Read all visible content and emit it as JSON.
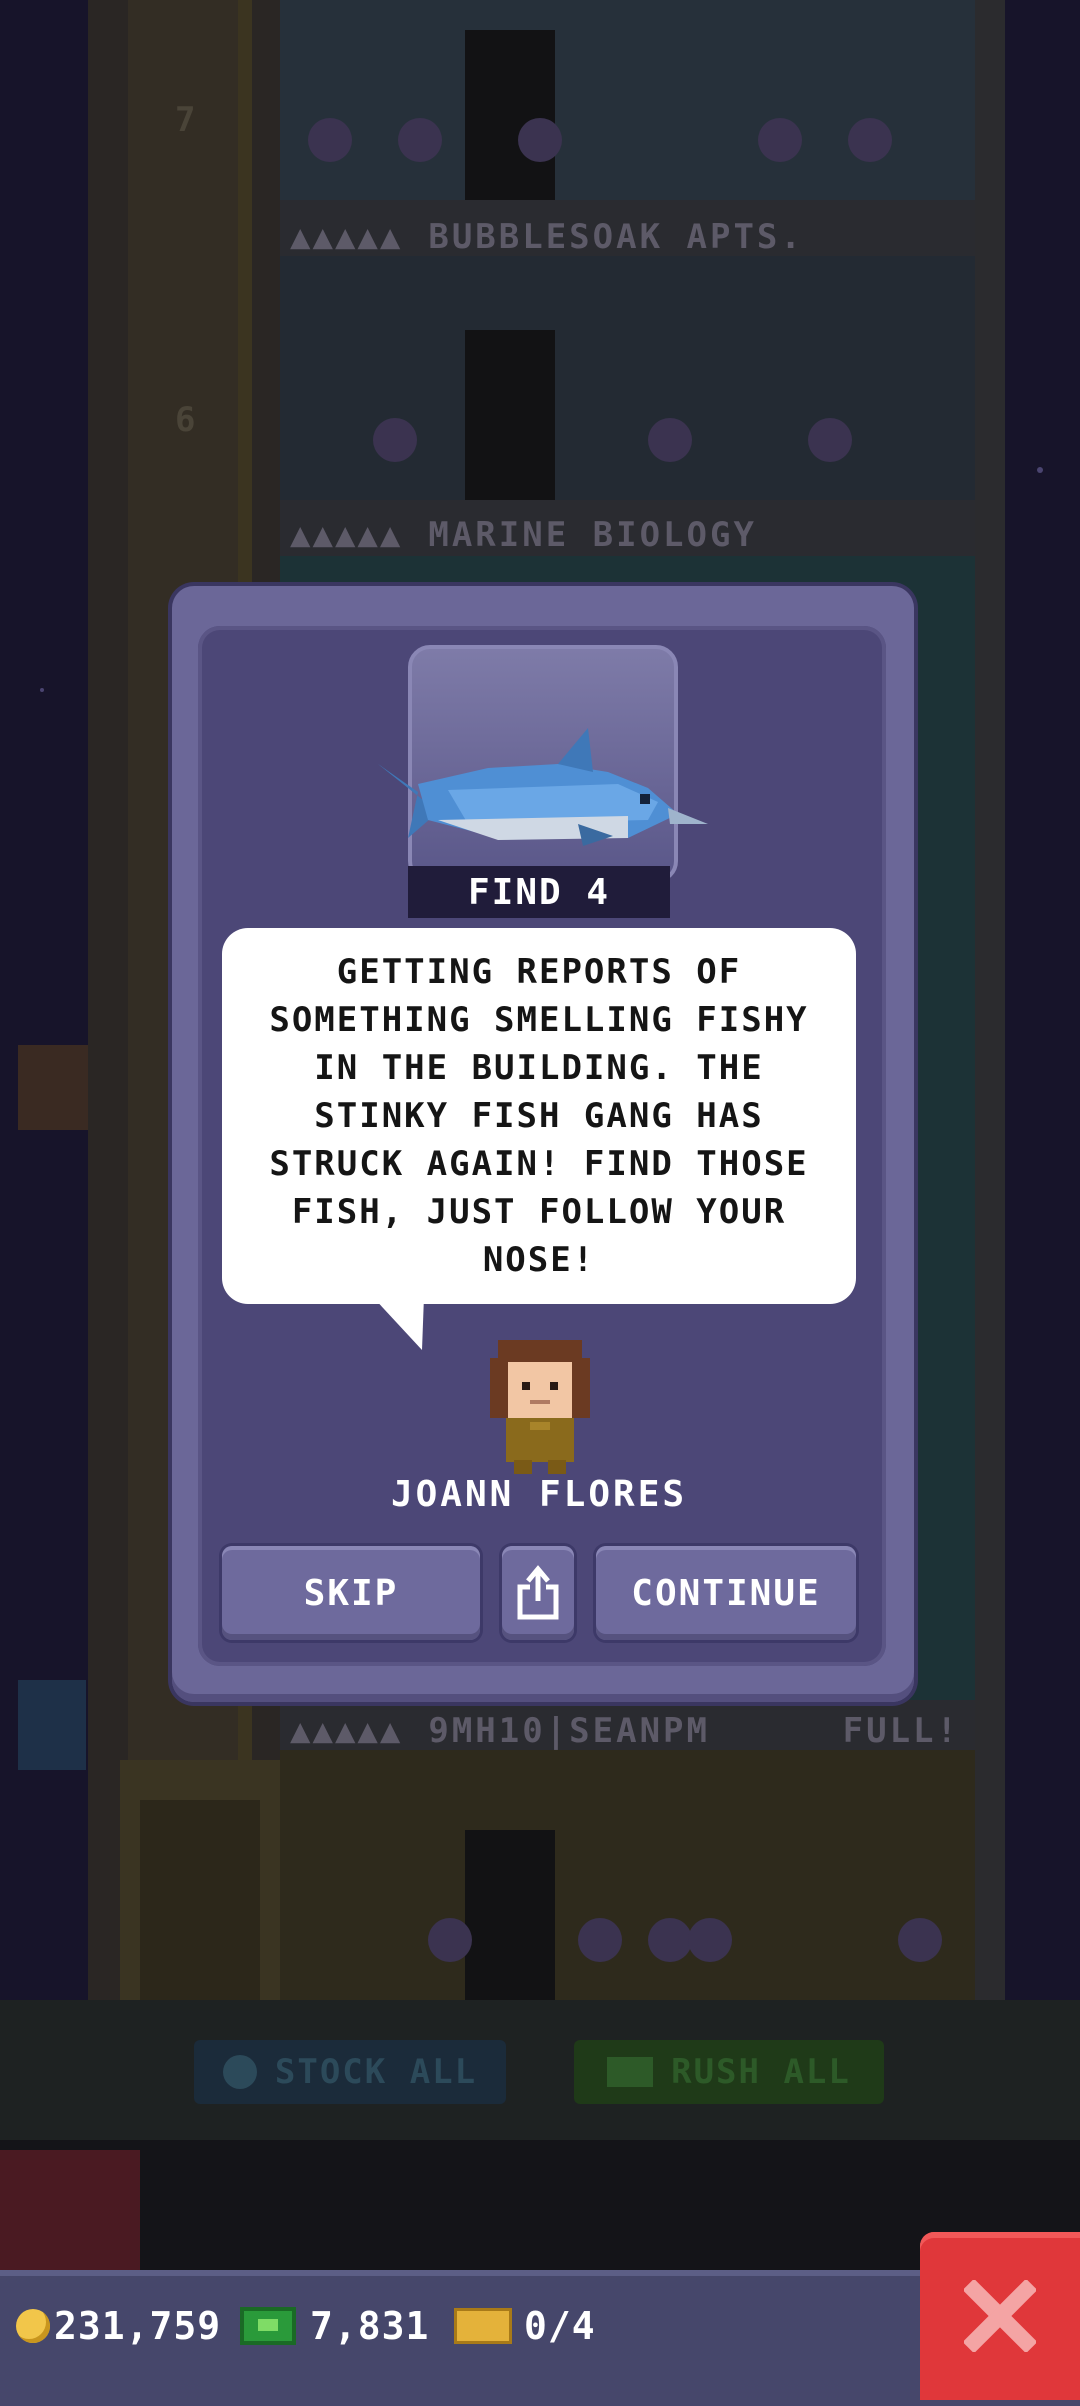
{
  "tower": {
    "floor_numbers": [
      "7",
      "6"
    ],
    "floors": [
      {
        "stars": "▲▲▲▲▲",
        "name": "BUBBLESOAK APTS.",
        "status": ""
      },
      {
        "stars": "▲▲▲▲▲",
        "name": "MARINE BIOLOGY",
        "status": ""
      },
      {
        "stars": "▲▲▲▲▲",
        "name": "9MH10|SEANPM",
        "status": "FULL!"
      }
    ]
  },
  "actions": {
    "stock_all": "STOCK ALL",
    "rush_all": "RUSH ALL"
  },
  "mission": {
    "find_label": "FIND 4",
    "target_icon": "swordfish-icon",
    "message": "GETTING REPORTS OF\nSOMETHING SMELLING FISHY\nIN THE BUILDING. THE\nSTINKY FISH GANG HAS\nSTRUCK AGAIN! FIND THOSE\nFISH, JUST FOLLOW YOUR\nNOSE!",
    "character_name": "JOANN FLORES",
    "skip_label": "SKIP",
    "share_icon": "share-icon",
    "continue_label": "CONTINUE"
  },
  "status_bar": {
    "coins": "231,759",
    "bux": "7,831",
    "tickets": "0/4"
  },
  "colors": {
    "modal_outer": "#6b6798",
    "modal_inner": "#4c4777",
    "button": "#6e6a9d",
    "close_red": "#e0373a",
    "bottom_bar": "#46476b"
  }
}
